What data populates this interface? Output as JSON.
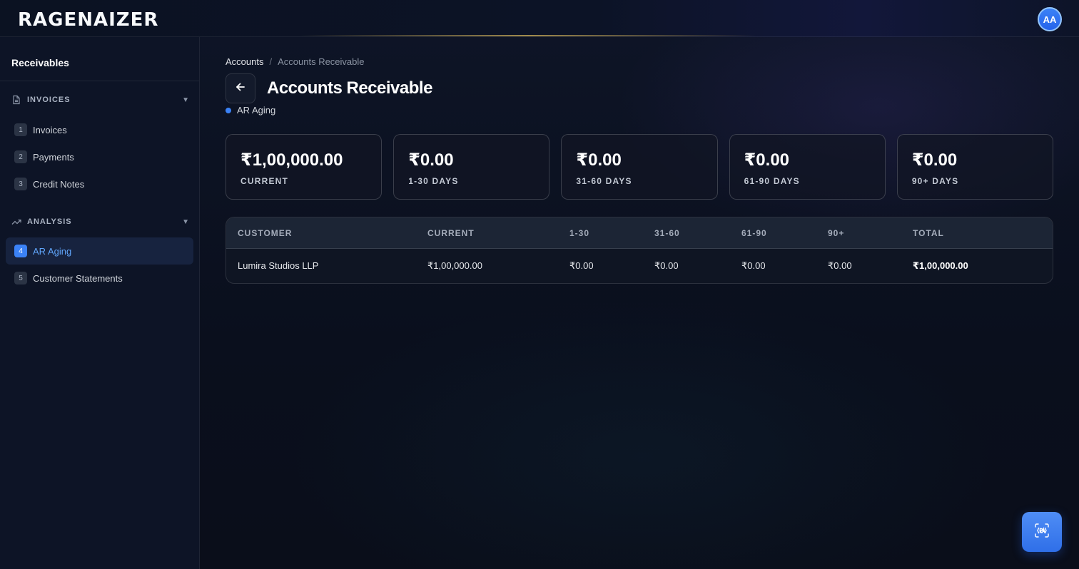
{
  "header": {
    "logo": "RAGENAIZER",
    "avatar_initials": "AA"
  },
  "sidebar": {
    "title": "Receivables",
    "sections": [
      {
        "label": "INVOICES",
        "icon": "document-icon"
      },
      {
        "label": "ANALYSIS",
        "icon": "trend-icon"
      }
    ],
    "items": [
      {
        "num": "1",
        "label": "Invoices"
      },
      {
        "num": "2",
        "label": "Payments"
      },
      {
        "num": "3",
        "label": "Credit Notes"
      },
      {
        "num": "4",
        "label": "AR Aging"
      },
      {
        "num": "5",
        "label": "Customer Statements"
      }
    ],
    "active_item": "AR Aging"
  },
  "breadcrumb": {
    "parent": "Accounts",
    "separator": "/",
    "current": "Accounts Receivable"
  },
  "page": {
    "title": "Accounts Receivable",
    "subtitle": "AR Aging"
  },
  "summary_cards": [
    {
      "value": "₹1,00,000.00",
      "label": "CURRENT"
    },
    {
      "value": "₹0.00",
      "label": "1-30 DAYS"
    },
    {
      "value": "₹0.00",
      "label": "31-60 DAYS"
    },
    {
      "value": "₹0.00",
      "label": "61-90 DAYS"
    },
    {
      "value": "₹0.00",
      "label": "90+ DAYS"
    }
  ],
  "table": {
    "headers": [
      "CUSTOMER",
      "CURRENT",
      "1-30",
      "31-60",
      "61-90",
      "90+",
      "TOTAL"
    ],
    "rows": [
      [
        "Lumira Studios LLP",
        "₹1,00,000.00",
        "₹0.00",
        "₹0.00",
        "₹0.00",
        "₹0.00",
        "₹1,00,000.00"
      ]
    ]
  },
  "colors": {
    "accent": "#3b82f6",
    "background": "#0b1120"
  }
}
